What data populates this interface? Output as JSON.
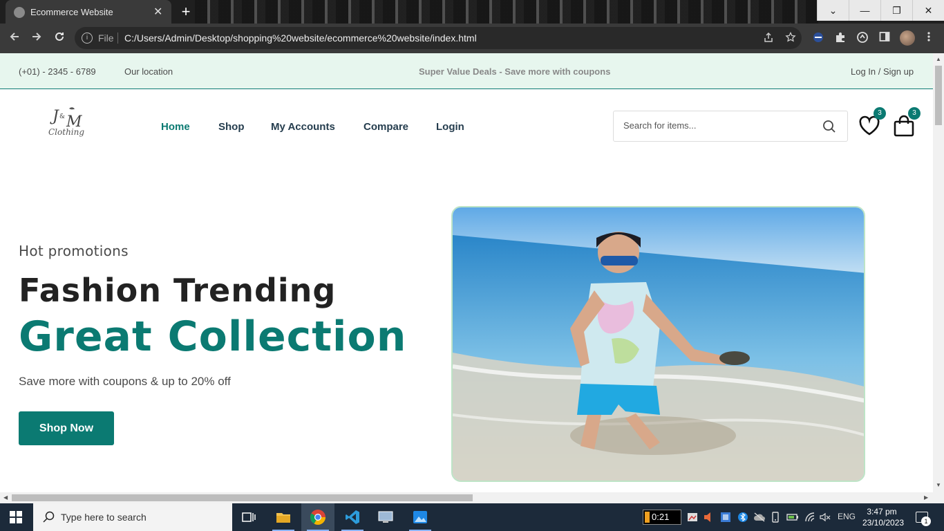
{
  "browser": {
    "tab_title": "Ecommerce Website",
    "close_tab": "✕",
    "new_tab": "+",
    "window_controls": {
      "dropdown": "⌄",
      "minimize": "—",
      "restore": "❐",
      "close": "✕"
    },
    "file_label": "File",
    "url": "C:/Users/Admin/Desktop/shopping%20website/ecommerce%20website/index.html",
    "icons": [
      "back-icon",
      "forward-icon",
      "reload-icon",
      "info-icon",
      "share-icon",
      "star-icon",
      "extension-icon",
      "puzzle-icon",
      "sync-icon",
      "sidebar-icon",
      "profile-avatar",
      "menu-icon"
    ]
  },
  "topbar": {
    "phone": "(+01) - 2345 - 6789",
    "location": "Our location",
    "deal": "Super Value Deals - Save more with coupons",
    "auth": "Log In / Sign up"
  },
  "header": {
    "logo_alt": "J&M Clothing",
    "nav": [
      {
        "label": "Home",
        "active": true
      },
      {
        "label": "Shop",
        "active": false
      },
      {
        "label": "My Accounts",
        "active": false
      },
      {
        "label": "Compare",
        "active": false
      },
      {
        "label": "Login",
        "active": false
      }
    ],
    "search_placeholder": "Search for items...",
    "wishlist_count": "3",
    "cart_count": "3"
  },
  "hero": {
    "subtitle": "Hot promotions",
    "title": "Fashion Trending",
    "highlight": "Great Collection",
    "text": "Save more with coupons & up to 20% off",
    "button": "Shop Now"
  },
  "taskbar": {
    "search_text": "Type here to search",
    "timer": "0:21",
    "lang": "ENG",
    "time": "3:47 pm",
    "date": "23/10/2023",
    "notification_count": "1"
  },
  "colors": {
    "accent": "#0b7a72",
    "topbar_bg": "#e7f6ee",
    "chrome_dark": "#3a3a3a"
  }
}
